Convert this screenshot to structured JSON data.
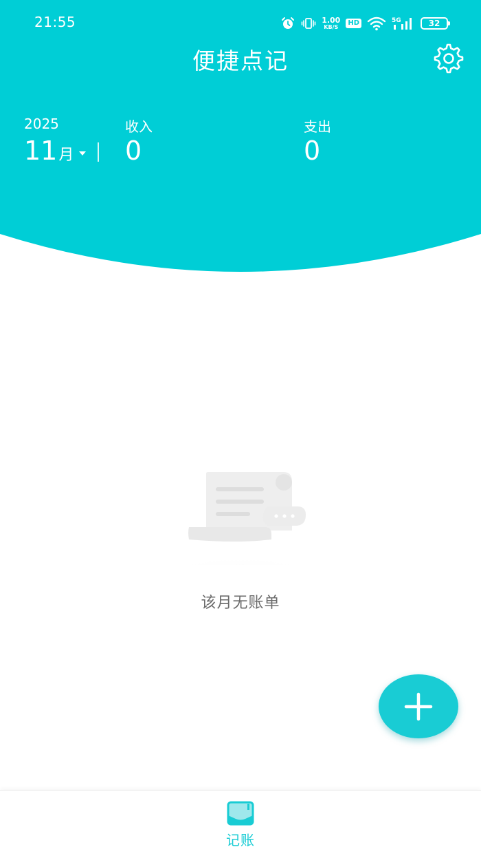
{
  "status_bar": {
    "time": "21:55",
    "net_speed_value": "1.00",
    "net_speed_unit": "KB/S",
    "hd_label": "HD",
    "network_label": "5G",
    "battery_level": "32",
    "icons": [
      "alarm-icon",
      "vibrate-icon",
      "wifi-icon",
      "signal-icon",
      "battery-icon"
    ]
  },
  "header": {
    "title": "便捷点记",
    "settings_icon": "gear-icon"
  },
  "summary": {
    "year": "2025",
    "month_number": "11",
    "month_suffix": "月",
    "income_label": "收入",
    "income_value": "0",
    "expense_label": "支出",
    "expense_value": "0"
  },
  "empty_state": {
    "message": "该月无账单",
    "illustration_icon": "empty-bill-icon"
  },
  "fab": {
    "icon": "plus-icon"
  },
  "bottom_nav": {
    "items": [
      {
        "label": "记账",
        "icon": "ledger-icon",
        "active": true
      }
    ]
  },
  "colors": {
    "primary": "#00CED6",
    "accent": "#19CCD4",
    "empty_text": "#6B6B6B",
    "background": "#FFFFFF"
  }
}
